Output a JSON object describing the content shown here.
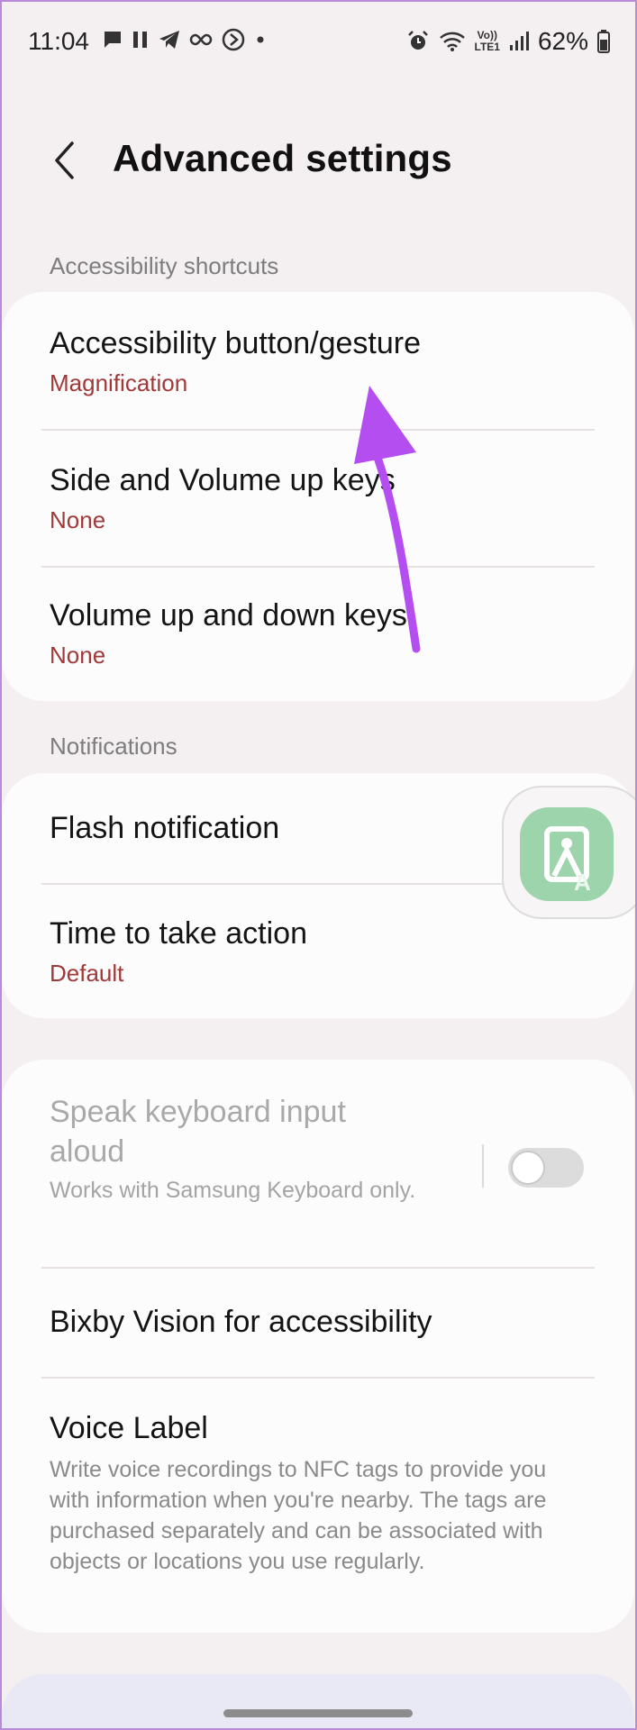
{
  "status_bar": {
    "time": "11:04",
    "battery": "62%",
    "network": "LTE1",
    "volte": "Vo))"
  },
  "header": {
    "title": "Advanced settings"
  },
  "sections": {
    "accessibility_shortcuts": {
      "label": "Accessibility shortcuts",
      "items": [
        {
          "title": "Accessibility button/gesture",
          "value": "Magnification"
        },
        {
          "title": "Side and Volume up keys",
          "value": "None"
        },
        {
          "title": "Volume up and down keys",
          "value": "None"
        }
      ]
    },
    "notifications": {
      "label": "Notifications",
      "items": [
        {
          "title": "Flash notification"
        },
        {
          "title": "Time to take action",
          "value": "Default"
        }
      ]
    },
    "other": {
      "items": [
        {
          "title": "Speak keyboard input aloud",
          "description": "Works with Samsung Keyboard only.",
          "enabled": false,
          "toggle_on": false
        },
        {
          "title": "Bixby Vision for accessibility"
        },
        {
          "title": "Voice Label",
          "description": "Write voice recordings to NFC tags to provide you with information when you're nearby. The tags are purchased separately and can be associated with objects or locations you use regularly."
        }
      ]
    }
  },
  "colors": {
    "background": "#f4eff1",
    "card": "#fcfcfd",
    "value_text": "#a03a3a",
    "annotation_arrow": "#b44ef0",
    "floating_button": "#9ed4ac"
  }
}
